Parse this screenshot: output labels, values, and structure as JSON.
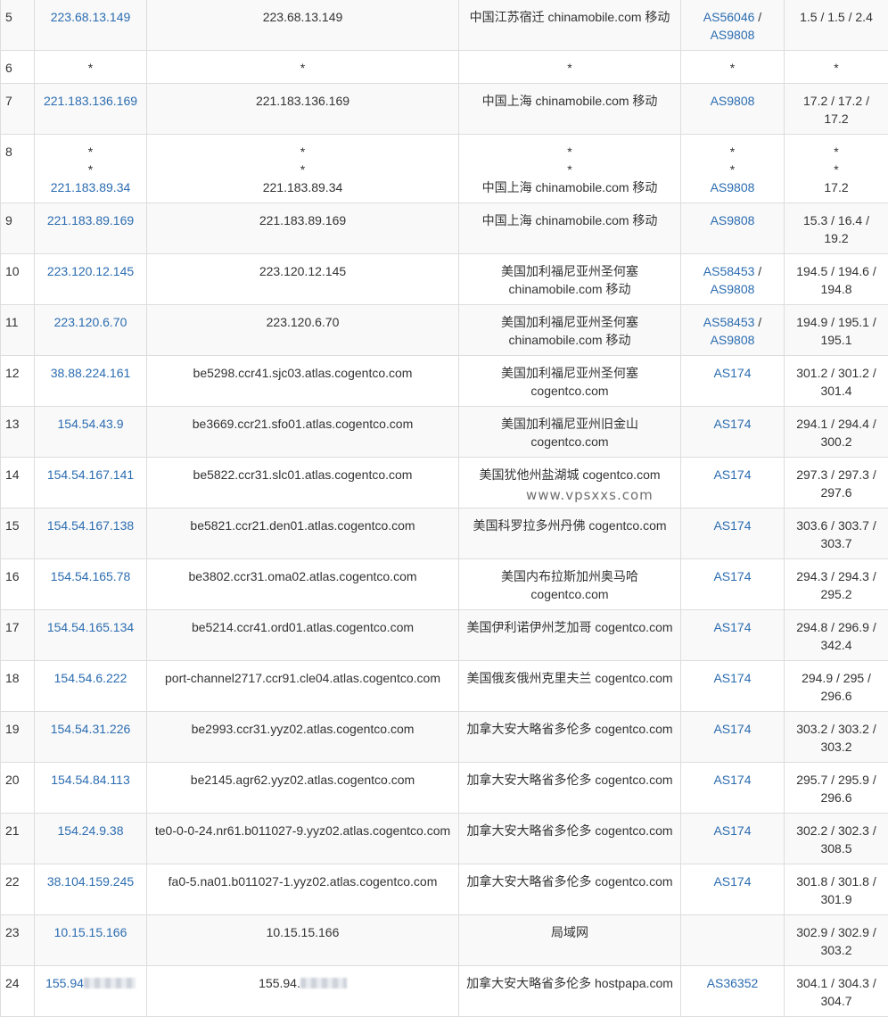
{
  "watermark": "www.vpsxxs.com",
  "rows": [
    {
      "hop": "5",
      "ip": "223.68.13.149",
      "host": "223.68.13.149",
      "loc": "中国江苏宿迁 chinamobile.com 移动",
      "asn": [
        "AS56046",
        "AS9808"
      ],
      "rtt": "1.5 / 1.5 / 2.4"
    },
    {
      "hop": "6",
      "ip": "*",
      "host": "*",
      "loc": "*",
      "asn": [
        "*"
      ],
      "rtt": "*"
    },
    {
      "hop": "7",
      "ip": "221.183.136.169",
      "host": "221.183.136.169",
      "loc": "中国上海 chinamobile.com 移动",
      "asn": [
        "AS9808"
      ],
      "rtt": "17.2 / 17.2 / 17.2"
    },
    {
      "hop": "8",
      "ip": [
        "*",
        "*",
        "221.183.89.34"
      ],
      "host": [
        "*",
        "*",
        "221.183.89.34"
      ],
      "loc": [
        "*",
        "*",
        "中国上海 chinamobile.com 移动"
      ],
      "asn": [
        "*",
        "*",
        "AS9808"
      ],
      "rtt": [
        "*",
        "*",
        "17.2"
      ]
    },
    {
      "hop": "9",
      "ip": "221.183.89.169",
      "host": "221.183.89.169",
      "loc": "中国上海 chinamobile.com 移动",
      "asn": [
        "AS9808"
      ],
      "rtt": "15.3 / 16.4 / 19.2"
    },
    {
      "hop": "10",
      "ip": "223.120.12.145",
      "host": "223.120.12.145",
      "loc": "美国加利福尼亚州圣何塞 chinamobile.com 移动",
      "asn": [
        "AS58453",
        "AS9808"
      ],
      "rtt": "194.5 / 194.6 / 194.8"
    },
    {
      "hop": "11",
      "ip": "223.120.6.70",
      "host": "223.120.6.70",
      "loc": "美国加利福尼亚州圣何塞 chinamobile.com 移动",
      "asn": [
        "AS58453",
        "AS9808"
      ],
      "rtt": "194.9 / 195.1 / 195.1"
    },
    {
      "hop": "12",
      "ip": "38.88.224.161",
      "host": "be5298.ccr41.sjc03.atlas.cogentco.com",
      "loc": "美国加利福尼亚州圣何塞 cogentco.com",
      "asn": [
        "AS174"
      ],
      "rtt": "301.2 / 301.2 / 301.4"
    },
    {
      "hop": "13",
      "ip": "154.54.43.9",
      "host": "be3669.ccr21.sfo01.atlas.cogentco.com",
      "loc": "美国加利福尼亚州旧金山 cogentco.com",
      "asn": [
        "AS174"
      ],
      "rtt": "294.1 / 294.4 / 300.2"
    },
    {
      "hop": "14",
      "ip": "154.54.167.141",
      "host": "be5822.ccr31.slc01.atlas.cogentco.com",
      "loc": "美国犹他州盐湖城 cogentco.com",
      "asn": [
        "AS174"
      ],
      "rtt": "297.3 / 297.3 / 297.6"
    },
    {
      "hop": "15",
      "ip": "154.54.167.138",
      "host": "be5821.ccr21.den01.atlas.cogentco.com",
      "loc": "美国科罗拉多州丹佛 cogentco.com",
      "asn": [
        "AS174"
      ],
      "rtt": "303.6 / 303.7 / 303.7"
    },
    {
      "hop": "16",
      "ip": "154.54.165.78",
      "host": "be3802.ccr31.oma02.atlas.cogentco.com",
      "loc": "美国内布拉斯加州奥马哈 cogentco.com",
      "asn": [
        "AS174"
      ],
      "rtt": "294.3 / 294.3 / 295.2"
    },
    {
      "hop": "17",
      "ip": "154.54.165.134",
      "host": "be5214.ccr41.ord01.atlas.cogentco.com",
      "loc": "美国伊利诺伊州芝加哥 cogentco.com",
      "asn": [
        "AS174"
      ],
      "rtt": "294.8 / 296.9 / 342.4"
    },
    {
      "hop": "18",
      "ip": "154.54.6.222",
      "host": "port-channel2717.ccr91.cle04.atlas.cogentco.com",
      "loc": "美国俄亥俄州克里夫兰 cogentco.com",
      "asn": [
        "AS174"
      ],
      "rtt": "294.9 / 295 / 296.6"
    },
    {
      "hop": "19",
      "ip": "154.54.31.226",
      "host": "be2993.ccr31.yyz02.atlas.cogentco.com",
      "loc": "加拿大安大略省多伦多 cogentco.com",
      "asn": [
        "AS174"
      ],
      "rtt": "303.2 / 303.2 / 303.2"
    },
    {
      "hop": "20",
      "ip": "154.54.84.113",
      "host": "be2145.agr62.yyz02.atlas.cogentco.com",
      "loc": "加拿大安大略省多伦多 cogentco.com",
      "asn": [
        "AS174"
      ],
      "rtt": "295.7 / 295.9 / 296.6"
    },
    {
      "hop": "21",
      "ip": "154.24.9.38",
      "host": "te0-0-0-24.nr61.b011027-9.yyz02.atlas.cogentco.com",
      "loc": "加拿大安大略省多伦多 cogentco.com",
      "asn": [
        "AS174"
      ],
      "rtt": "302.2 / 302.3 / 308.5"
    },
    {
      "hop": "22",
      "ip": "38.104.159.245",
      "host": "fa0-5.na01.b011027-1.yyz02.atlas.cogentco.com",
      "loc": "加拿大安大略省多伦多 cogentco.com",
      "asn": [
        "AS174"
      ],
      "rtt": "301.8 / 301.8 / 301.9"
    },
    {
      "hop": "23",
      "ip": "10.15.15.166",
      "host": "10.15.15.166",
      "loc": "局域网",
      "asn": [],
      "rtt": "302.9 / 302.9 / 303.2"
    },
    {
      "hop": "24",
      "ip": "155.94",
      "host": "155.94.",
      "loc": "加拿大安大略省多伦多 hostpapa.com",
      "asn": [
        "AS36352"
      ],
      "rtt": "304.1 / 304.3 / 304.7",
      "redacted": true
    }
  ]
}
